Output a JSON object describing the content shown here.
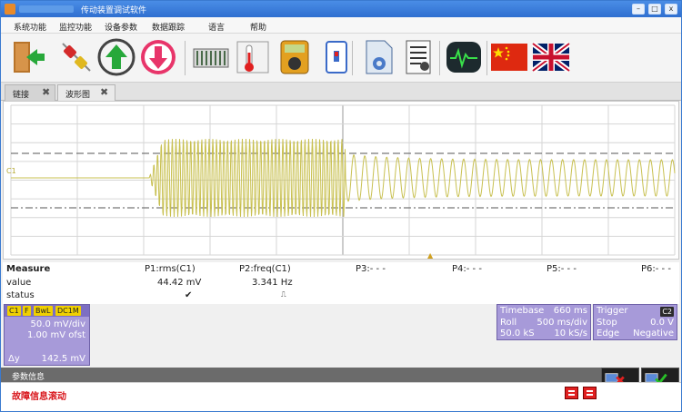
{
  "window": {
    "title": "传动装置调试软件",
    "minimize_glyph": "–",
    "restore_glyph": "□",
    "close_glyph": "x"
  },
  "menu": [
    "系统功能",
    "监控功能",
    "设备参数",
    "数据跟踪",
    "语言",
    "帮助"
  ],
  "toolbar": {
    "icons": [
      "exit-door-icon",
      "disconnect-plug-icon",
      "upload-arrow-icon",
      "download-arrow-icon",
      "parameter-bank-icon",
      "thermometer-icon",
      "meter-gauge-icon",
      "phone-device-icon",
      "settings-document-icon",
      "config-sheet-icon",
      "oscilloscope-icon",
      "chinese-flag-icon",
      "english-flag-icon"
    ]
  },
  "tabs": [
    {
      "label": "链接",
      "close": "✖"
    },
    {
      "label": "波形图",
      "close": "✖"
    }
  ],
  "scope": {
    "channel_label": "C1",
    "trigger_marker": "▲",
    "channel_color": "#c8c050",
    "grid_color": "#d6d6d6"
  },
  "measure": {
    "title": "Measure",
    "row_labels": [
      "value",
      "status"
    ],
    "columns": [
      {
        "param": "P1:rms(C1)",
        "value": "44.42 mV",
        "status": "✔"
      },
      {
        "param": "P2:freq(C1)",
        "value": "3.341 Hz",
        "status": "⎍"
      },
      {
        "param": "P3:- - -",
        "value": "",
        "status": ""
      },
      {
        "param": "P4:- - -",
        "value": "",
        "status": ""
      },
      {
        "param": "P5:- - -",
        "value": "",
        "status": ""
      },
      {
        "param": "P6:- - -",
        "value": "",
        "status": ""
      }
    ]
  },
  "channel_box": {
    "name": "C1",
    "badges": [
      "F",
      "BwL",
      "DC1M"
    ],
    "vdiv": "50.0 mV/div",
    "offset": "1.00 mV ofst",
    "delta_label": "Δy",
    "delta_value": "142.5 mV"
  },
  "timebase_box": {
    "title": "Timebase",
    "title_value": "660 ms",
    "row1_label": "Roll",
    "row1_value": "500 ms/div",
    "row2_label": "50.0 kS",
    "row2_value": "10 kS/s"
  },
  "trigger_box": {
    "title": "Trigger",
    "badge": "C2",
    "row1_label": "Stop",
    "row1_value": "0.0 V",
    "row2_label": "Edge",
    "row2_value": "Negative"
  },
  "param_panel": {
    "title": "参数信息"
  },
  "status": {
    "fault_text": "故障信息滚动"
  },
  "net_icons": [
    "network-disconnected-icon",
    "network-connected-icon"
  ],
  "colors": {
    "fault": "#d8141a",
    "panel": "#a79ad9",
    "titlebar": "#2f6fd0"
  }
}
